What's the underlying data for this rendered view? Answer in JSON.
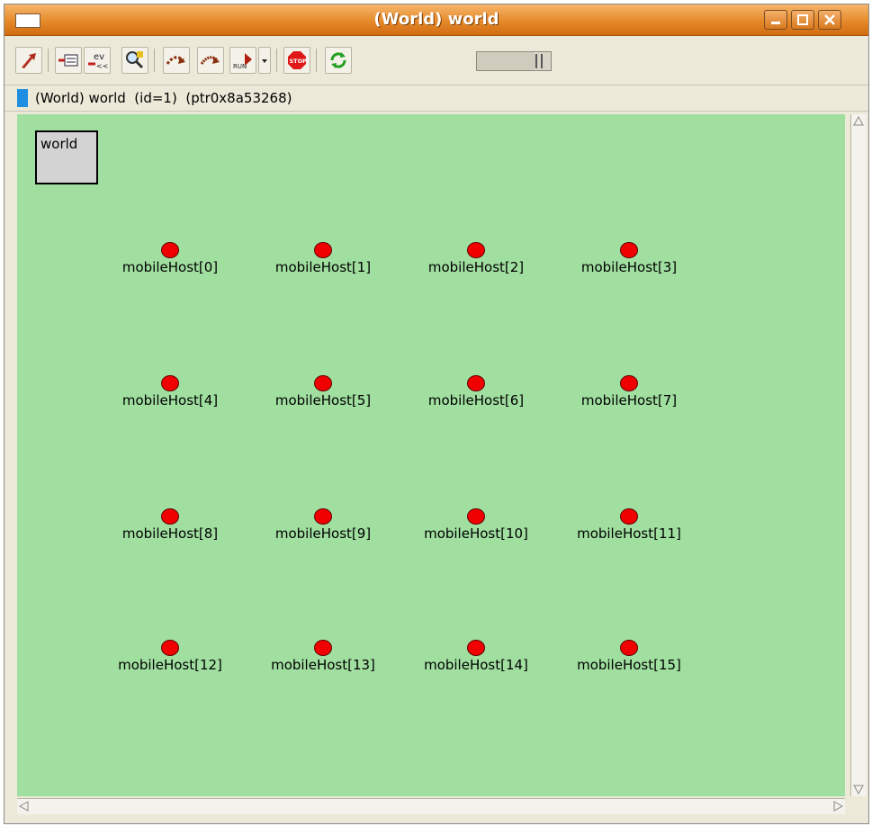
{
  "window": {
    "title": "(World) world",
    "controls": [
      "minimize-icon",
      "maximize-icon",
      "close-icon"
    ]
  },
  "toolbar": {
    "buttons": [
      {
        "name": "step-out-button",
        "icon": "step-out-icon"
      },
      {
        "name": "object-inspector-button",
        "icon": "inspector-icon"
      },
      {
        "name": "event-log-button",
        "icon": "ev-log-icon",
        "label": "ev"
      },
      {
        "name": "find-object-button",
        "icon": "find-icon"
      },
      {
        "name": "step-button",
        "icon": "step-icon"
      },
      {
        "name": "fast-step-button",
        "icon": "fast-step-icon"
      },
      {
        "name": "run-button",
        "icon": "run-icon",
        "label": "RUN"
      },
      {
        "name": "run-mode-dropdown",
        "icon": "chevron-down-icon"
      },
      {
        "name": "stop-button",
        "icon": "stop-icon",
        "label": "STOP"
      },
      {
        "name": "refresh-button",
        "icon": "refresh-icon"
      }
    ],
    "speed_slider": {
      "value": 0.88
    }
  },
  "info": {
    "text": "(World) world  (id=1)  (ptr0x8a53268)",
    "swatch_color": "#1e8ee0"
  },
  "canvas": {
    "background": "#a0dfa0",
    "world_box": {
      "label": "world"
    },
    "nodes": [
      "mobileHost[0]",
      "mobileHost[1]",
      "mobileHost[2]",
      "mobileHost[3]",
      "mobileHost[4]",
      "mobileHost[5]",
      "mobileHost[6]",
      "mobileHost[7]",
      "mobileHost[8]",
      "mobileHost[9]",
      "mobileHost[10]",
      "mobileHost[11]",
      "mobileHost[12]",
      "mobileHost[13]",
      "mobileHost[14]",
      "mobileHost[15]"
    ],
    "node_color": "#f00000"
  }
}
